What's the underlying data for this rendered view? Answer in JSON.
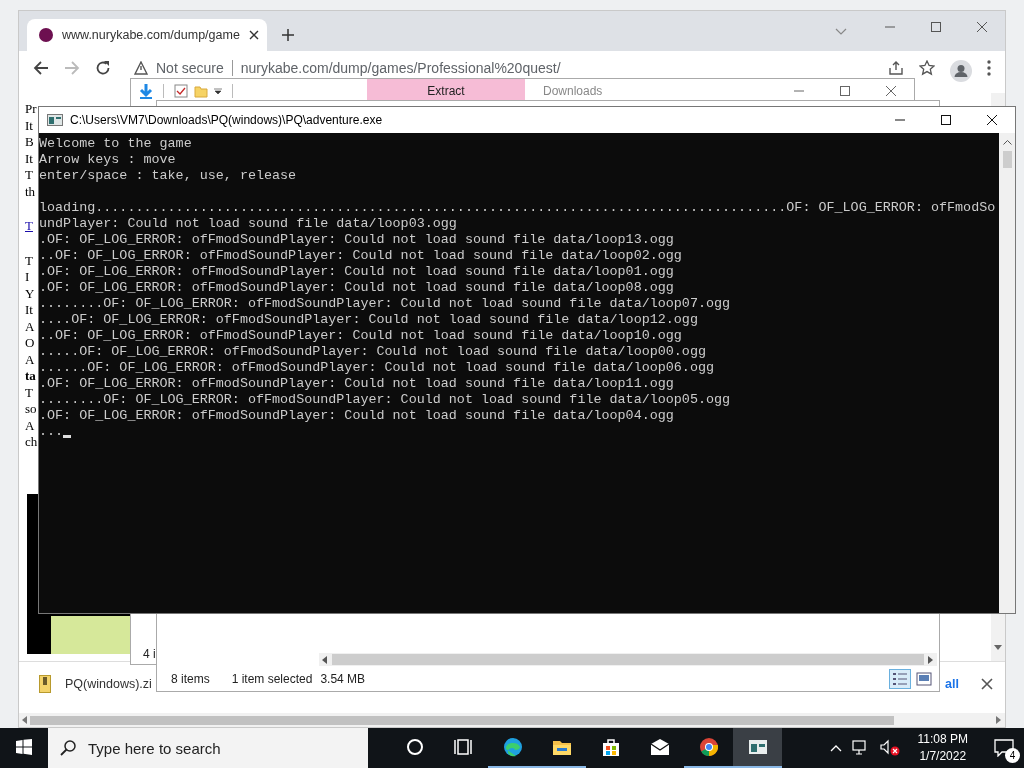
{
  "browser": {
    "tab_title": "www.nurykabe.com/dump/game",
    "address": {
      "security": "Not secure",
      "url": "nurykabe.com/dump/games/Professional%20quest/"
    },
    "page_paragraphs": [
      [
        {
          "text": "Pr",
          "kind": "plain"
        },
        {
          "text": "It",
          "kind": "plain"
        },
        {
          "text": "B",
          "kind": "plain"
        },
        {
          "text": "It",
          "kind": "plain"
        },
        {
          "text": "T",
          "kind": "plain"
        },
        {
          "text": "th",
          "kind": "plain"
        }
      ],
      [
        {
          "text": "T",
          "kind": "link"
        }
      ],
      [
        {
          "text": "T",
          "kind": "plain"
        },
        {
          "text": "I",
          "kind": "plain"
        },
        {
          "text": "Y",
          "kind": "plain"
        },
        {
          "text": "It",
          "kind": "plain"
        },
        {
          "text": "A",
          "kind": "plain"
        },
        {
          "text": "O",
          "kind": "plain"
        },
        {
          "text": "A",
          "kind": "plain"
        },
        {
          "text": "ta",
          "kind": "bold"
        },
        {
          "text": "T",
          "kind": "plain"
        },
        {
          "text": "so",
          "kind": "plain"
        },
        {
          "text": "A",
          "kind": "plain"
        },
        {
          "text": "ch",
          "kind": "plain"
        }
      ]
    ],
    "page_picture": {
      "kind": "picture"
    },
    "download_bar": {
      "file": "PQ(windows).zi",
      "show_all": "all"
    }
  },
  "explorer_back": {
    "ribbon_tab": "Extract",
    "title": "Downloads",
    "status": "4 i"
  },
  "explorer_front": {
    "item_count": "8 items",
    "selection": "1 item selected",
    "size": "3.54 MB",
    "views": [
      {
        "kind": "details",
        "selected": true
      },
      {
        "kind": "tiles",
        "selected": false
      }
    ]
  },
  "console": {
    "title": "C:\\Users\\VM7\\Downloads\\PQ(windows)\\PQ\\adventure.exe",
    "blocks": [
      [
        "Welcome to the game",
        "Arrow keys : move",
        "enter/space : take, use, release"
      ],
      [
        "loading......................................................................................OF: OF_LOG_ERROR: ofFmodSo",
        "undPlayer: Could not load sound file data/loop03.ogg",
        ".OF: OF_LOG_ERROR: ofFmodSoundPlayer: Could not load sound file data/loop13.ogg",
        "..OF: OF_LOG_ERROR: ofFmodSoundPlayer: Could not load sound file data/loop02.ogg",
        ".OF: OF_LOG_ERROR: ofFmodSoundPlayer: Could not load sound file data/loop01.ogg",
        ".OF: OF_LOG_ERROR: ofFmodSoundPlayer: Could not load sound file data/loop08.ogg",
        "........OF: OF_LOG_ERROR: ofFmodSoundPlayer: Could not load sound file data/loop07.ogg",
        "....OF: OF_LOG_ERROR: ofFmodSoundPlayer: Could not load sound file data/loop12.ogg",
        "..OF: OF_LOG_ERROR: ofFmodSoundPlayer: Could not load sound file data/loop10.ogg",
        ".....OF: OF_LOG_ERROR: ofFmodSoundPlayer: Could not load sound file data/loop00.ogg",
        "......OF: OF_LOG_ERROR: ofFmodSoundPlayer: Could not load sound file data/loop06.ogg",
        ".OF: OF_LOG_ERROR: ofFmodSoundPlayer: Could not load sound file data/loop11.ogg",
        "........OF: OF_LOG_ERROR: ofFmodSoundPlayer: Could not load sound file data/loop05.ogg",
        ".OF: OF_LOG_ERROR: ofFmodSoundPlayer: Could not load sound file data/loop04.ogg",
        "..."
      ]
    ]
  },
  "taskbar": {
    "search_placeholder": "Type here to search",
    "apps": [
      {
        "kind": "cortana",
        "running": false,
        "selected": false
      },
      {
        "kind": "taskview",
        "running": false,
        "selected": false
      },
      {
        "kind": "edge",
        "running": true,
        "selected": false
      },
      {
        "kind": "explorer",
        "running": true,
        "selected": false
      },
      {
        "kind": "store",
        "running": false,
        "selected": false
      },
      {
        "kind": "mail",
        "running": false,
        "selected": false
      },
      {
        "kind": "chrome",
        "running": true,
        "selected": false
      },
      {
        "kind": "console",
        "running": true,
        "selected": true
      }
    ],
    "time": "11:08 PM",
    "date": "1/7/2022",
    "notifications": "4"
  }
}
